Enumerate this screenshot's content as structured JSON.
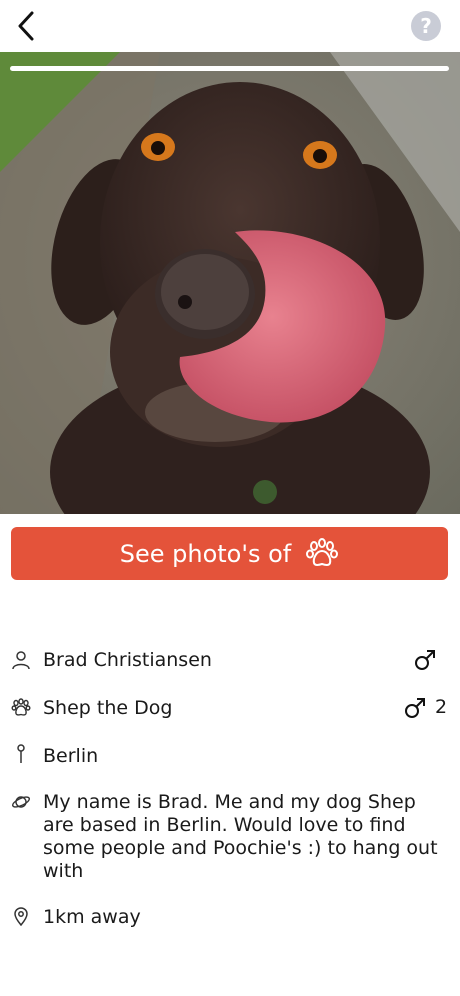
{
  "header": {
    "back_icon": "chevron-left-icon",
    "help_icon": "question-mark-icon",
    "help_glyph": "?"
  },
  "photo": {
    "subject": "brown dog licking its nose",
    "progress_fraction": 1.0
  },
  "cta": {
    "label": "See photo's of",
    "icon": "paw-icon",
    "color": "#e4533a"
  },
  "details": {
    "owner": {
      "icon": "person-icon",
      "name": "Brad Christiansen",
      "gender_icon": "male-symbol-icon"
    },
    "dog": {
      "icon": "paw-icon",
      "name": "Shep the Dog",
      "gender_icon": "male-symbol-icon",
      "count": "2"
    },
    "city": {
      "icon": "pin-icon",
      "name": "Berlin"
    },
    "bio": {
      "icon": "planet-icon",
      "text": "My name is Brad. Me and my dog Shep are based in Berlin. Would love to find some people and Poochie's :) to hang out with"
    },
    "distance": {
      "icon": "location-pin-icon",
      "text": "1km away"
    }
  }
}
